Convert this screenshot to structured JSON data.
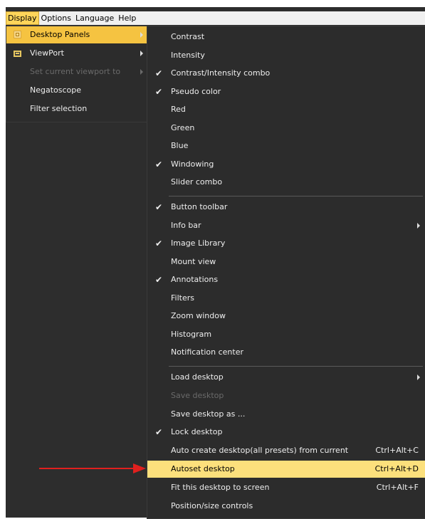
{
  "menubar": [
    "Display",
    "Options",
    "Language",
    "Help"
  ],
  "display_menu": [
    {
      "label": "Desktop Panels",
      "highlight": true,
      "submenu": true,
      "icon": "panels-icon"
    },
    {
      "label": "ViewPort",
      "submenu": true,
      "icon": "viewport-icon"
    },
    {
      "label": "Set current viewport to",
      "disabled": true,
      "submenu": true
    },
    {
      "label": "Negatoscope"
    },
    {
      "label": "Filter selection"
    }
  ],
  "panels_menu": {
    "group1": [
      {
        "label": "Contrast",
        "checked": false
      },
      {
        "label": "Intensity",
        "checked": false
      },
      {
        "label": "Contrast/Intensity combo",
        "checked": true
      },
      {
        "label": "Pseudo color",
        "checked": true
      },
      {
        "label": "Red",
        "checked": false
      },
      {
        "label": "Green",
        "checked": false
      },
      {
        "label": "Blue",
        "checked": false
      },
      {
        "label": "Windowing",
        "checked": true
      },
      {
        "label": "Slider combo",
        "checked": false
      }
    ],
    "group2": [
      {
        "label": "Button toolbar",
        "checked": true
      },
      {
        "label": "Info bar",
        "checked": false,
        "submenu": true
      },
      {
        "label": "Image Library",
        "checked": true
      },
      {
        "label": "Mount view",
        "checked": false
      },
      {
        "label": "Annotations",
        "checked": true
      },
      {
        "label": "Filters",
        "checked": false
      },
      {
        "label": "Zoom window",
        "checked": false
      },
      {
        "label": "Histogram",
        "checked": false
      },
      {
        "label": "Notification center",
        "checked": false
      }
    ],
    "group3": [
      {
        "label": "Load desktop",
        "submenu": true
      },
      {
        "label": "Save desktop",
        "disabled": true
      },
      {
        "label": "Save desktop as ..."
      },
      {
        "label": "Lock desktop",
        "checked": true
      },
      {
        "label": "Auto create desktop(all presets) from current",
        "shortcut": "Ctrl+Alt+C"
      },
      {
        "label": "Autoset desktop",
        "shortcut": "Ctrl+Alt+D",
        "highlight": true
      },
      {
        "label": "Fit this desktop to screen",
        "shortcut": "Ctrl+Alt+F"
      },
      {
        "label": "Position/size controls"
      }
    ]
  },
  "check_glyph": "✔",
  "colors": {
    "highlight": "#fce07c",
    "active_menu": "#ffd55a",
    "menu_bg": "#2c2c2c",
    "arrow": "#e0201e"
  }
}
